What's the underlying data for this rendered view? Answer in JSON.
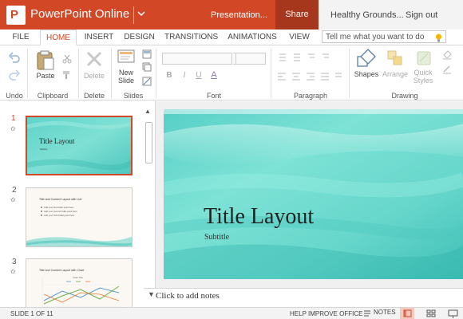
{
  "titlebar": {
    "app_logo_letter": "P",
    "app_name": "PowerPoint Online",
    "document_name": "Presentation...",
    "share_label": "Share",
    "user_name": "Healthy Grounds...",
    "signout_label": "Sign out",
    "accent_color": "#D24726"
  },
  "tabs": [
    "FILE",
    "HOME",
    "INSERT",
    "DESIGN",
    "TRANSITIONS",
    "ANIMATIONS",
    "VIEW"
  ],
  "active_tab": "HOME",
  "tell_me": {
    "placeholder": "Tell me what you want to do",
    "icon": "lightbulb-icon"
  },
  "ribbon": {
    "groups": {
      "undo": "Undo",
      "clipboard": "Clipboard",
      "delete": "Delete",
      "slides": "Slides",
      "font": "Font",
      "paragraph": "Paragraph",
      "drawing": "Drawing"
    },
    "buttons": {
      "paste": "Paste",
      "delete": "Delete",
      "new_slide_line1": "New",
      "new_slide_line2": "Slide",
      "shapes": "Shapes",
      "arrange": "Arrange",
      "quick_styles_line1": "Quick",
      "quick_styles_line2": "Styles"
    },
    "font_buttons": [
      "B",
      "I",
      "U",
      "A"
    ]
  },
  "thumbnails": [
    {
      "number": "1",
      "title": "Title Layout",
      "subtitle": "Subtitle",
      "selected": true
    },
    {
      "number": "2",
      "title": "Title and Content Layout with List",
      "bullets": [
        "Add your first bullet point here",
        "Add your second bullet point here",
        "Add your third bullet point here"
      ],
      "selected": false
    },
    {
      "number": "3",
      "title": "Title and Content Layout with Chart",
      "chart_title": "Chart Title",
      "selected": false
    }
  ],
  "slide": {
    "title": "Title Layout",
    "subtitle": "Subtitle"
  },
  "notes_placeholder": "Click to add notes",
  "status": {
    "slide_counter": "SLIDE 1 OF 11",
    "help_improve": "HELP IMPROVE OFFICE",
    "notes_label": "NOTES"
  }
}
